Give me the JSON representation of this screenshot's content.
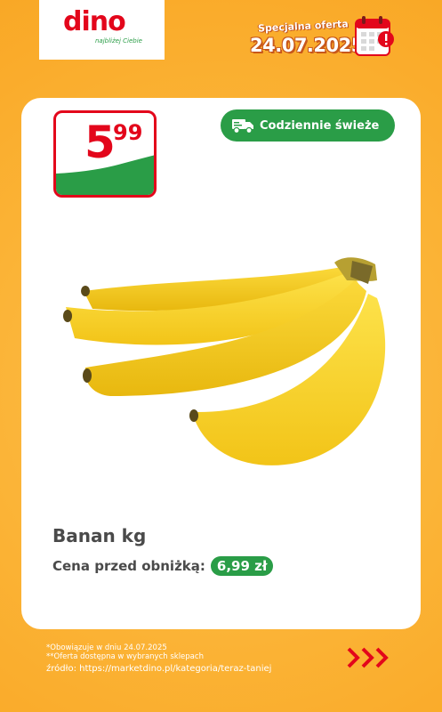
{
  "header": {
    "logo_text": "dino",
    "logo_tagline": "najbliżej Ciebie",
    "offer_label": "Specjalna oferta",
    "offer_date": "24.07.2025",
    "calendar_icon": "calendar-alert-icon"
  },
  "card": {
    "price": {
      "main": "5",
      "cents": "99"
    },
    "fresh_badge": {
      "icon": "delivery-truck-icon",
      "label": "Codziennie świeże"
    },
    "product_image": "bananas-image",
    "product_name": "Banan kg",
    "before_price_label": "Cena przed obniżką:",
    "before_price_value": "6,99 zł"
  },
  "footer": {
    "note1": "*Obowiązuje w dniu 24.07.2025",
    "note2": "**Oferta dostępna w wybranych sklepach",
    "source": "źródło: https://marketdino.pl/kategoria/teraz-taniej",
    "next_icon": "triple-chevron-right-icon"
  },
  "colors": {
    "background": "#fbb234",
    "brand_red": "#e3061b",
    "brand_green": "#2a9d47",
    "card": "#ffffff"
  }
}
